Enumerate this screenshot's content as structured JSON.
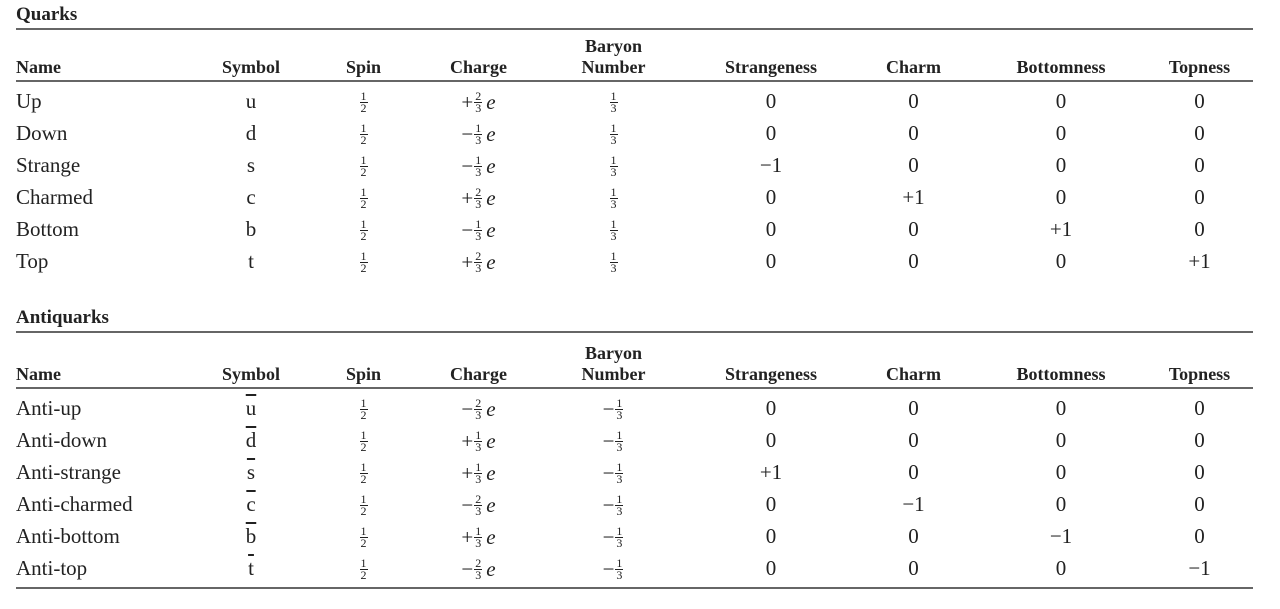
{
  "columns": [
    "Name",
    "Symbol",
    "Spin",
    "Charge",
    "Baryon Number",
    "Strangeness",
    "Charm",
    "Bottomness",
    "Topness"
  ],
  "header": {
    "name": "Name",
    "symbol": "Symbol",
    "spin": "Spin",
    "charge": "Charge",
    "baryon_top": "Baryon",
    "baryon_bottom": "Number",
    "strangeness": "Strangeness",
    "charm": "Charm",
    "bottomness": "Bottomness",
    "topness": "Topness"
  },
  "quarks": {
    "title": "Quarks",
    "rows": [
      {
        "name": "Up",
        "symbol": "u",
        "spin": {
          "sign": "",
          "num": "1",
          "den": "2"
        },
        "charge": {
          "sign": "+",
          "num": "2",
          "den": "3",
          "unit": "e"
        },
        "baryon": {
          "sign": "",
          "num": "1",
          "den": "3"
        },
        "strangeness": "0",
        "charm": "0",
        "bottomness": "0",
        "topness": "0"
      },
      {
        "name": "Down",
        "symbol": "d",
        "spin": {
          "sign": "",
          "num": "1",
          "den": "2"
        },
        "charge": {
          "sign": "−",
          "num": "1",
          "den": "3",
          "unit": "e"
        },
        "baryon": {
          "sign": "",
          "num": "1",
          "den": "3"
        },
        "strangeness": "0",
        "charm": "0",
        "bottomness": "0",
        "topness": "0"
      },
      {
        "name": "Strange",
        "symbol": "s",
        "spin": {
          "sign": "",
          "num": "1",
          "den": "2"
        },
        "charge": {
          "sign": "−",
          "num": "1",
          "den": "3",
          "unit": "e"
        },
        "baryon": {
          "sign": "",
          "num": "1",
          "den": "3"
        },
        "strangeness": "−1",
        "charm": "0",
        "bottomness": "0",
        "topness": "0"
      },
      {
        "name": "Charmed",
        "symbol": "c",
        "spin": {
          "sign": "",
          "num": "1",
          "den": "2"
        },
        "charge": {
          "sign": "+",
          "num": "2",
          "den": "3",
          "unit": "e"
        },
        "baryon": {
          "sign": "",
          "num": "1",
          "den": "3"
        },
        "strangeness": "0",
        "charm": "+1",
        "bottomness": "0",
        "topness": "0"
      },
      {
        "name": "Bottom",
        "symbol": "b",
        "spin": {
          "sign": "",
          "num": "1",
          "den": "2"
        },
        "charge": {
          "sign": "−",
          "num": "1",
          "den": "3",
          "unit": "e"
        },
        "baryon": {
          "sign": "",
          "num": "1",
          "den": "3"
        },
        "strangeness": "0",
        "charm": "0",
        "bottomness": "+1",
        "topness": "0"
      },
      {
        "name": "Top",
        "symbol": "t",
        "spin": {
          "sign": "",
          "num": "1",
          "den": "2"
        },
        "charge": {
          "sign": "+",
          "num": "2",
          "den": "3",
          "unit": "e"
        },
        "baryon": {
          "sign": "",
          "num": "1",
          "den": "3"
        },
        "strangeness": "0",
        "charm": "0",
        "bottomness": "0",
        "topness": "+1"
      }
    ]
  },
  "antiquarks": {
    "title": "Antiquarks",
    "rows": [
      {
        "name": "Anti-up",
        "symbol": "u",
        "symbol_overbar": true,
        "spin": {
          "sign": "",
          "num": "1",
          "den": "2"
        },
        "charge": {
          "sign": "−",
          "num": "2",
          "den": "3",
          "unit": "e"
        },
        "baryon": {
          "sign": "−",
          "num": "1",
          "den": "3"
        },
        "strangeness": "0",
        "charm": "0",
        "bottomness": "0",
        "topness": "0"
      },
      {
        "name": "Anti-down",
        "symbol": "d",
        "symbol_overbar": true,
        "spin": {
          "sign": "",
          "num": "1",
          "den": "2"
        },
        "charge": {
          "sign": "+",
          "num": "1",
          "den": "3",
          "unit": "e"
        },
        "baryon": {
          "sign": "−",
          "num": "1",
          "den": "3"
        },
        "strangeness": "0",
        "charm": "0",
        "bottomness": "0",
        "topness": "0"
      },
      {
        "name": "Anti-strange",
        "symbol": "s",
        "symbol_overbar": true,
        "spin": {
          "sign": "",
          "num": "1",
          "den": "2"
        },
        "charge": {
          "sign": "+",
          "num": "1",
          "den": "3",
          "unit": "e"
        },
        "baryon": {
          "sign": "−",
          "num": "1",
          "den": "3"
        },
        "strangeness": "+1",
        "charm": "0",
        "bottomness": "0",
        "topness": "0"
      },
      {
        "name": "Anti-charmed",
        "symbol": "c",
        "symbol_overbar": true,
        "spin": {
          "sign": "",
          "num": "1",
          "den": "2"
        },
        "charge": {
          "sign": "−",
          "num": "2",
          "den": "3",
          "unit": "e"
        },
        "baryon": {
          "sign": "−",
          "num": "1",
          "den": "3"
        },
        "strangeness": "0",
        "charm": "−1",
        "bottomness": "0",
        "topness": "0"
      },
      {
        "name": "Anti-bottom",
        "symbol": "b",
        "symbol_overbar": true,
        "spin": {
          "sign": "",
          "num": "1",
          "den": "2"
        },
        "charge": {
          "sign": "+",
          "num": "1",
          "den": "3",
          "unit": "e"
        },
        "baryon": {
          "sign": "−",
          "num": "1",
          "den": "3"
        },
        "strangeness": "0",
        "charm": "0",
        "bottomness": "−1",
        "topness": "0"
      },
      {
        "name": "Anti-top",
        "symbol": "t",
        "symbol_overbar": true,
        "spin": {
          "sign": "",
          "num": "1",
          "den": "2"
        },
        "charge": {
          "sign": "−",
          "num": "2",
          "den": "3",
          "unit": "e"
        },
        "baryon": {
          "sign": "−",
          "num": "1",
          "den": "3"
        },
        "strangeness": "0",
        "charm": "0",
        "bottomness": "0",
        "topness": "−1"
      }
    ]
  }
}
